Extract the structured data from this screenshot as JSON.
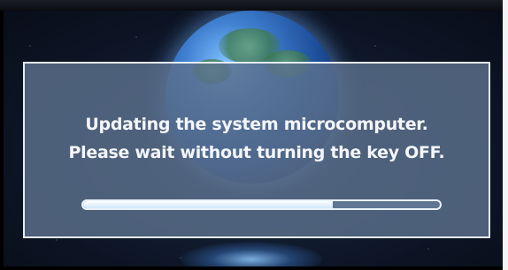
{
  "dialog": {
    "line1": "Updating the system microcomputer.",
    "line2": "Please wait without turning the key OFF."
  },
  "progress": {
    "fraction": 0.7
  },
  "background": {
    "image": "earth-globe"
  },
  "colors": {
    "panel": "#5c708c",
    "panel_border": "#e6ecf3",
    "text": "#f4f6fa",
    "progress_fill": "#ffffff",
    "progress_track": "#5f7592"
  }
}
